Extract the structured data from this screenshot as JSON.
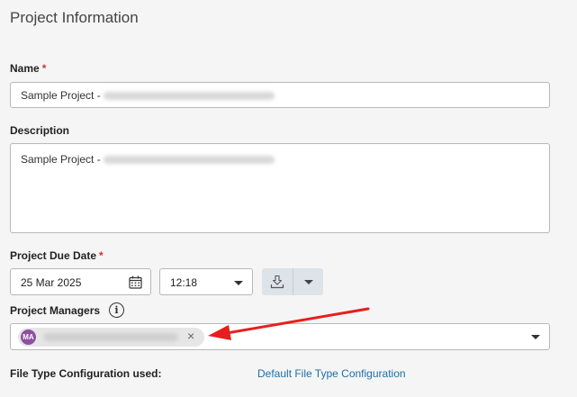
{
  "page": {
    "title": "Project Information"
  },
  "name_field": {
    "label": "Name",
    "required_mark": "*",
    "value": "Sample Project -"
  },
  "description_field": {
    "label": "Description",
    "value": "Sample Project -"
  },
  "due_date": {
    "label": "Project Due Date",
    "required_mark": "*",
    "date": "25 Mar 2025",
    "time": "12:18"
  },
  "project_managers": {
    "label": "Project Managers",
    "info_glyph": "i",
    "chips": [
      {
        "initials": "MA",
        "close_glyph": "×"
      }
    ]
  },
  "file_type": {
    "label": "File Type Configuration used:",
    "link": "Default File Type Configuration"
  },
  "colors": {
    "required": "#d32f2f",
    "link": "#1d6fa5",
    "avatar": "#8e4fa3",
    "annotation_arrow": "#e81e1e"
  }
}
